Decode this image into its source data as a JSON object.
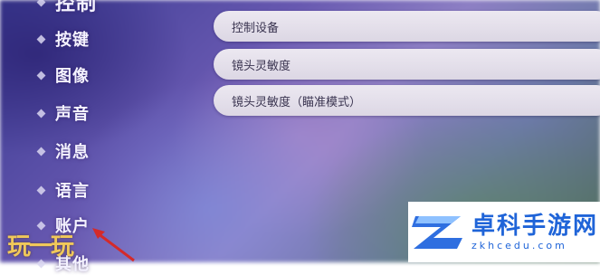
{
  "sidebar": {
    "top_partial": "控制",
    "items": [
      {
        "label": "按键"
      },
      {
        "label": "图像"
      },
      {
        "label": "声音"
      },
      {
        "label": "消息"
      },
      {
        "label": "语言"
      },
      {
        "label": "账户"
      }
    ],
    "bottom_partial": "其他"
  },
  "settings": {
    "rows": [
      {
        "label": "控制设备"
      },
      {
        "label": "镜头灵敏度"
      },
      {
        "label": "镜头灵敏度（瞄准模式）"
      }
    ]
  },
  "watermark_left": {
    "text": "玩一玩"
  },
  "watermark_right": {
    "title": "卓科手游网",
    "url": "zkhcedu.com"
  }
}
